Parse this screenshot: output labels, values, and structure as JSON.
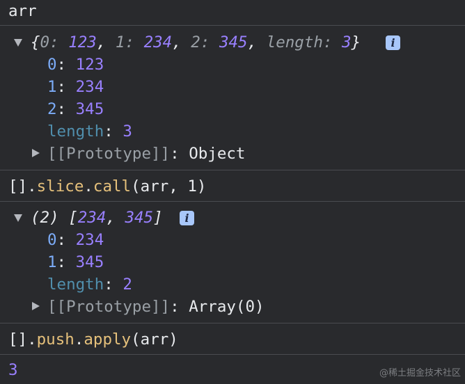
{
  "console": {
    "input1": "arr",
    "obj": {
      "summary_open": "{",
      "summary_close": "}",
      "entries": [
        {
          "key": "0",
          "value": "123"
        },
        {
          "key": "1",
          "value": "234"
        },
        {
          "key": "2",
          "value": "345"
        },
        {
          "key": "length",
          "value": "3"
        }
      ],
      "props": [
        {
          "key": "0",
          "value": "123"
        },
        {
          "key": "1",
          "value": "234"
        },
        {
          "key": "2",
          "value": "345"
        },
        {
          "key": "length",
          "value": "3"
        }
      ],
      "proto_label": "[[Prototype]]",
      "proto_value": "Object",
      "info_badge": "i"
    },
    "input2": {
      "prefix": "[].",
      "method1": "slice",
      "dot": ".",
      "method2": "call",
      "args": "(arr, 1)"
    },
    "arr": {
      "count": "(2)",
      "open": "[",
      "close": "]",
      "values": [
        "234",
        "345"
      ],
      "props": [
        {
          "key": "0",
          "value": "234"
        },
        {
          "key": "1",
          "value": "345"
        },
        {
          "key": "length",
          "value": "2"
        }
      ],
      "proto_label": "[[Prototype]]",
      "proto_value": "Array(0)",
      "info_badge": "i"
    },
    "input3": {
      "prefix": "[].",
      "method1": "push",
      "dot": ".",
      "method2": "apply",
      "args": "(arr)"
    },
    "result3": "3"
  },
  "watermark": "@稀土掘金技术社区",
  "colors": {
    "background": "#292a2d",
    "number": "#9980ff",
    "key": "#7cacf8",
    "method": "#e5c07b",
    "info_badge": "#a8c7fa"
  }
}
